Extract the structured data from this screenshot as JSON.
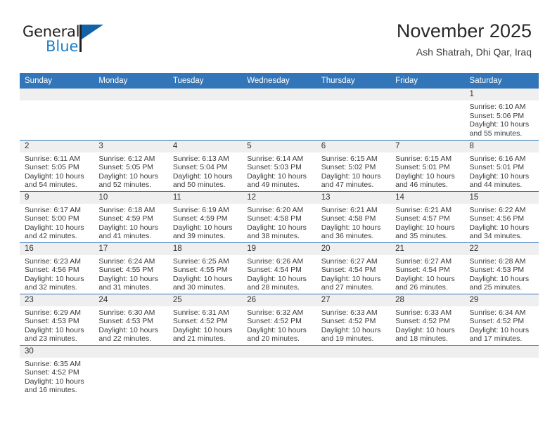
{
  "brand": {
    "name_part1": "General",
    "name_part2": "Blue",
    "accent_color": "#1b7ec9",
    "flag_color": "#1362a8"
  },
  "header": {
    "title": "November 2025",
    "subtitle": "Ash Shatrah, Dhi Qar, Iraq"
  },
  "theme": {
    "header_blue": "#3275b8",
    "daynum_gray": "#efefef",
    "text": "#333333"
  },
  "weekday_headers": [
    "Sunday",
    "Monday",
    "Tuesday",
    "Wednesday",
    "Thursday",
    "Friday",
    "Saturday"
  ],
  "labels": {
    "sunrise": "Sunrise:",
    "sunset": "Sunset:",
    "daylight": "Daylight:"
  },
  "weeks": [
    [
      {
        "day": "",
        "empty": true
      },
      {
        "day": "",
        "empty": true
      },
      {
        "day": "",
        "empty": true
      },
      {
        "day": "",
        "empty": true
      },
      {
        "day": "",
        "empty": true
      },
      {
        "day": "",
        "empty": true
      },
      {
        "day": "1",
        "sunrise": "Sunrise: 6:10 AM",
        "sunset": "Sunset: 5:06 PM",
        "daylight_line1": "Daylight: 10 hours",
        "daylight_line2": "and 55 minutes."
      }
    ],
    [
      {
        "day": "2",
        "sunrise": "Sunrise: 6:11 AM",
        "sunset": "Sunset: 5:05 PM",
        "daylight_line1": "Daylight: 10 hours",
        "daylight_line2": "and 54 minutes."
      },
      {
        "day": "3",
        "sunrise": "Sunrise: 6:12 AM",
        "sunset": "Sunset: 5:05 PM",
        "daylight_line1": "Daylight: 10 hours",
        "daylight_line2": "and 52 minutes."
      },
      {
        "day": "4",
        "sunrise": "Sunrise: 6:13 AM",
        "sunset": "Sunset: 5:04 PM",
        "daylight_line1": "Daylight: 10 hours",
        "daylight_line2": "and 50 minutes."
      },
      {
        "day": "5",
        "sunrise": "Sunrise: 6:14 AM",
        "sunset": "Sunset: 5:03 PM",
        "daylight_line1": "Daylight: 10 hours",
        "daylight_line2": "and 49 minutes."
      },
      {
        "day": "6",
        "sunrise": "Sunrise: 6:15 AM",
        "sunset": "Sunset: 5:02 PM",
        "daylight_line1": "Daylight: 10 hours",
        "daylight_line2": "and 47 minutes."
      },
      {
        "day": "7",
        "sunrise": "Sunrise: 6:15 AM",
        "sunset": "Sunset: 5:01 PM",
        "daylight_line1": "Daylight: 10 hours",
        "daylight_line2": "and 46 minutes."
      },
      {
        "day": "8",
        "sunrise": "Sunrise: 6:16 AM",
        "sunset": "Sunset: 5:01 PM",
        "daylight_line1": "Daylight: 10 hours",
        "daylight_line2": "and 44 minutes."
      }
    ],
    [
      {
        "day": "9",
        "sunrise": "Sunrise: 6:17 AM",
        "sunset": "Sunset: 5:00 PM",
        "daylight_line1": "Daylight: 10 hours",
        "daylight_line2": "and 42 minutes."
      },
      {
        "day": "10",
        "sunrise": "Sunrise: 6:18 AM",
        "sunset": "Sunset: 4:59 PM",
        "daylight_line1": "Daylight: 10 hours",
        "daylight_line2": "and 41 minutes."
      },
      {
        "day": "11",
        "sunrise": "Sunrise: 6:19 AM",
        "sunset": "Sunset: 4:59 PM",
        "daylight_line1": "Daylight: 10 hours",
        "daylight_line2": "and 39 minutes."
      },
      {
        "day": "12",
        "sunrise": "Sunrise: 6:20 AM",
        "sunset": "Sunset: 4:58 PM",
        "daylight_line1": "Daylight: 10 hours",
        "daylight_line2": "and 38 minutes."
      },
      {
        "day": "13",
        "sunrise": "Sunrise: 6:21 AM",
        "sunset": "Sunset: 4:58 PM",
        "daylight_line1": "Daylight: 10 hours",
        "daylight_line2": "and 36 minutes."
      },
      {
        "day": "14",
        "sunrise": "Sunrise: 6:21 AM",
        "sunset": "Sunset: 4:57 PM",
        "daylight_line1": "Daylight: 10 hours",
        "daylight_line2": "and 35 minutes."
      },
      {
        "day": "15",
        "sunrise": "Sunrise: 6:22 AM",
        "sunset": "Sunset: 4:56 PM",
        "daylight_line1": "Daylight: 10 hours",
        "daylight_line2": "and 34 minutes."
      }
    ],
    [
      {
        "day": "16",
        "sunrise": "Sunrise: 6:23 AM",
        "sunset": "Sunset: 4:56 PM",
        "daylight_line1": "Daylight: 10 hours",
        "daylight_line2": "and 32 minutes."
      },
      {
        "day": "17",
        "sunrise": "Sunrise: 6:24 AM",
        "sunset": "Sunset: 4:55 PM",
        "daylight_line1": "Daylight: 10 hours",
        "daylight_line2": "and 31 minutes."
      },
      {
        "day": "18",
        "sunrise": "Sunrise: 6:25 AM",
        "sunset": "Sunset: 4:55 PM",
        "daylight_line1": "Daylight: 10 hours",
        "daylight_line2": "and 30 minutes."
      },
      {
        "day": "19",
        "sunrise": "Sunrise: 6:26 AM",
        "sunset": "Sunset: 4:54 PM",
        "daylight_line1": "Daylight: 10 hours",
        "daylight_line2": "and 28 minutes."
      },
      {
        "day": "20",
        "sunrise": "Sunrise: 6:27 AM",
        "sunset": "Sunset: 4:54 PM",
        "daylight_line1": "Daylight: 10 hours",
        "daylight_line2": "and 27 minutes."
      },
      {
        "day": "21",
        "sunrise": "Sunrise: 6:27 AM",
        "sunset": "Sunset: 4:54 PM",
        "daylight_line1": "Daylight: 10 hours",
        "daylight_line2": "and 26 minutes."
      },
      {
        "day": "22",
        "sunrise": "Sunrise: 6:28 AM",
        "sunset": "Sunset: 4:53 PM",
        "daylight_line1": "Daylight: 10 hours",
        "daylight_line2": "and 25 minutes."
      }
    ],
    [
      {
        "day": "23",
        "sunrise": "Sunrise: 6:29 AM",
        "sunset": "Sunset: 4:53 PM",
        "daylight_line1": "Daylight: 10 hours",
        "daylight_line2": "and 23 minutes."
      },
      {
        "day": "24",
        "sunrise": "Sunrise: 6:30 AM",
        "sunset": "Sunset: 4:53 PM",
        "daylight_line1": "Daylight: 10 hours",
        "daylight_line2": "and 22 minutes."
      },
      {
        "day": "25",
        "sunrise": "Sunrise: 6:31 AM",
        "sunset": "Sunset: 4:52 PM",
        "daylight_line1": "Daylight: 10 hours",
        "daylight_line2": "and 21 minutes."
      },
      {
        "day": "26",
        "sunrise": "Sunrise: 6:32 AM",
        "sunset": "Sunset: 4:52 PM",
        "daylight_line1": "Daylight: 10 hours",
        "daylight_line2": "and 20 minutes."
      },
      {
        "day": "27",
        "sunrise": "Sunrise: 6:33 AM",
        "sunset": "Sunset: 4:52 PM",
        "daylight_line1": "Daylight: 10 hours",
        "daylight_line2": "and 19 minutes."
      },
      {
        "day": "28",
        "sunrise": "Sunrise: 6:33 AM",
        "sunset": "Sunset: 4:52 PM",
        "daylight_line1": "Daylight: 10 hours",
        "daylight_line2": "and 18 minutes."
      },
      {
        "day": "29",
        "sunrise": "Sunrise: 6:34 AM",
        "sunset": "Sunset: 4:52 PM",
        "daylight_line1": "Daylight: 10 hours",
        "daylight_line2": "and 17 minutes."
      }
    ],
    [
      {
        "day": "30",
        "sunrise": "Sunrise: 6:35 AM",
        "sunset": "Sunset: 4:52 PM",
        "daylight_line1": "Daylight: 10 hours",
        "daylight_line2": "and 16 minutes."
      },
      {
        "day": "",
        "empty": true
      },
      {
        "day": "",
        "empty": true
      },
      {
        "day": "",
        "empty": true
      },
      {
        "day": "",
        "empty": true
      },
      {
        "day": "",
        "empty": true
      },
      {
        "day": "",
        "empty": true
      }
    ]
  ]
}
